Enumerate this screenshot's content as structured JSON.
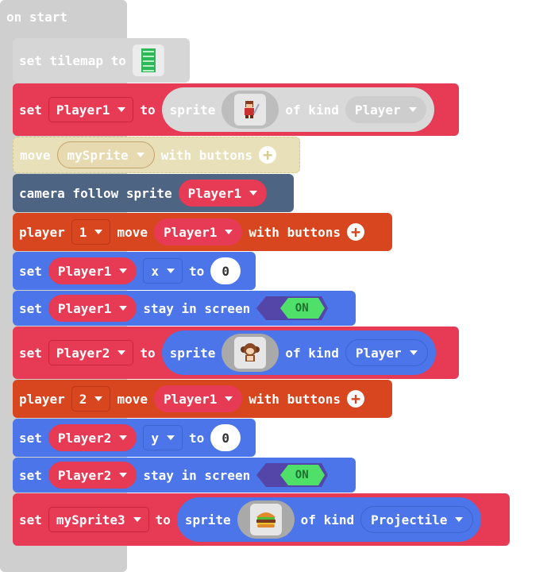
{
  "on_start": {
    "label": "on start"
  },
  "set_tilemap": {
    "prefix": "set tilemap to"
  },
  "set_player1_sprite": {
    "set": "set",
    "variable": "Player1",
    "to": "to",
    "sprite": "sprite",
    "of_kind": "of kind",
    "kind": "Player"
  },
  "move_mysprite": {
    "move": "move",
    "variable": "mySprite",
    "with_buttons": "with buttons"
  },
  "camera_follow": {
    "text": "camera follow sprite",
    "variable": "Player1"
  },
  "player1_move": {
    "player": "player",
    "number": "1",
    "move": "move",
    "variable": "Player1",
    "with_buttons": "with buttons"
  },
  "set_player1_x": {
    "set": "set",
    "variable": "Player1",
    "property": "x",
    "to": "to",
    "value": "0"
  },
  "player1_stay": {
    "set": "set",
    "variable": "Player1",
    "text": "stay in screen",
    "toggle": "ON"
  },
  "set_player2_sprite": {
    "set": "set",
    "variable": "Player2",
    "to": "to",
    "sprite": "sprite",
    "of_kind": "of kind",
    "kind": "Player"
  },
  "player2_move": {
    "player": "player",
    "number": "2",
    "move": "move",
    "variable": "Player1",
    "with_buttons": "with buttons"
  },
  "set_player2_y": {
    "set": "set",
    "variable": "Player2",
    "property": "y",
    "to": "to",
    "value": "0"
  },
  "player2_stay": {
    "set": "set",
    "variable": "Player2",
    "text": "stay in screen",
    "toggle": "ON"
  },
  "set_mysprite3": {
    "set": "set",
    "variable": "mySprite3",
    "to": "to",
    "sprite": "sprite",
    "of_kind": "of kind",
    "kind": "Projectile"
  },
  "colors": {
    "sprites_red": "#E63A55",
    "sprites_dark_red": "#C9253F",
    "blue": "#4B75E8",
    "blue_dark": "#3D63CF",
    "orange": "#D8461F",
    "orange_dark": "#BA3617",
    "camera": "#4D6483",
    "disabled": "#CFCFCF",
    "toggle_green": "#4FE06A",
    "toggle_purple": "#5446A8"
  }
}
